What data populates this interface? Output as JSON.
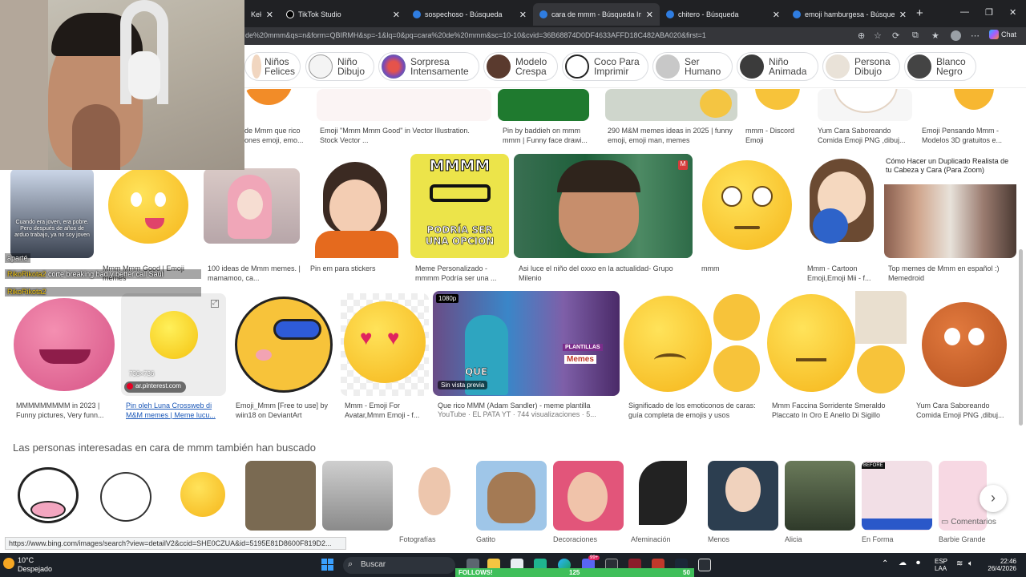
{
  "browser": {
    "tabs": [
      {
        "title": "Kekelar",
        "active": false
      },
      {
        "title": "TikTok Studio",
        "active": false
      },
      {
        "title": "sospechoso - Búsqueda",
        "active": false
      },
      {
        "title": "cara de mmm - Búsqueda Imágenes",
        "active": true
      },
      {
        "title": "chitero - Búsqueda",
        "active": false
      },
      {
        "title": "emoji hamburgesa - Búsqueda",
        "active": false
      }
    ],
    "url": "de%20mmm&qs=n&form=QBIRMH&sp=-1&lq=0&pq=cara%20de%20mmm&sc=10-10&cvid=36B68874D0DF4633AFFD18C482ABA020&first=1",
    "chat_label": "Chat"
  },
  "chips": [
    {
      "line1": "Niños",
      "line2": "Felices"
    },
    {
      "line1": "Niño",
      "line2": "Dibujo"
    },
    {
      "line1": "Sorpresa",
      "line2": "Intensamente"
    },
    {
      "line1": "Modelo",
      "line2": "Crespa"
    },
    {
      "line1": "Coco Para",
      "line2": "Imprimir"
    },
    {
      "line1": "Ser",
      "line2": "Humano"
    },
    {
      "line1": "Niño",
      "line2": "Animada"
    },
    {
      "line1": "Persona",
      "line2": "Dibujo"
    },
    {
      "line1": "Blanco",
      "line2": "Negro"
    }
  ],
  "row1_captions": [
    "de Mmm que rico ones emoji, emo...",
    "Emoji \"Mmm Mmm Good\" in Vector Illustration. Stock Vector ...",
    "Pin by baddieh on mmm mmm | Funny face drawi...",
    "290 M&M memes ideas in 2025 | funny emoji, emoji man, memes",
    "mmm - Discord Emoji",
    "Yum Cara Saboreando Comida Emoji PNG ,dibuj...",
    "Emoji Pensando Mmm - Modelos 3D gratuitos e..."
  ],
  "row2_captions": [
    "Mmm Mmm Good | Emoji memes",
    "100 ideas de Mmm memes. | mamamoo, ca...",
    "Pin em para stickers",
    "Meme Personalizado - mmmm Podría ser una ...",
    "Asi luce el niño del oxxo en la actualidad- Grupo Milenio",
    "mmm",
    "Mmm - Cartoon Emoji,Emoji Mii - f...",
    "Top memes de Mmm en español :) Memedroid"
  ],
  "row2_texts": {
    "spongebob_top": "MMMM",
    "spongebob_bottom": "PODRÍA SER UNA OPCION",
    "tutorial_title": "Cómo Hacer un Duplicado Realista de tu Cabeza y Cara (Para Zoom)",
    "card_text": "Cuando era joven, era pobre. Pero después de años de arduo trabajo, ya no soy joven"
  },
  "row3_captions": [
    "MMMMMMMMM in 2023 | Funny pictures, Very funn...",
    "Pin oleh Luna Crossweb di M&M memes | Meme lucu...",
    "Emoji_Mmm [Free to use] by wiin18 on DeviantArt",
    "Mmm - Emoji For Avatar,Mmm Emoji - f...",
    "Que rico MMM (Adam Sandler) - meme plantilla",
    "YouTube · EL PATA YT · 744 visualizaciones · 5...",
    "Significado de los emoticonos de caras: guía completa de emojis y usos",
    "Mmm Faccina Sorridente Smeraldo Placcato In Oro E Anello Di Sigillo",
    "Yum Cara Saboreando Comida Emoji PNG ,dibuj..."
  ],
  "row3_overlays": {
    "dims": "736×736",
    "source": "ar.pinterest.com",
    "badge_1080": "1080p",
    "sin_vista": "Sin vista previa",
    "que": "QUE",
    "plantillas": "PLANTILLAS",
    "memes": "Memes"
  },
  "related": {
    "title": "Las personas interesadas en cara de mmm también han buscado",
    "captions": [
      "Fotografías",
      "Gatito",
      "Decoraciones",
      "Afeminación",
      "Menos",
      "Alicia",
      "En Forma",
      "Barbie Grande"
    ],
    "feedback": "Comentarios"
  },
  "status_url": "https://www.bing.com/images/search?view=detailV2&ccid=SHE0CZUA&id=5195E81D8600F819D2...",
  "stream": {
    "chat_user_1": "aparté",
    "chat_user_2": "RikoRikota2",
    "chat_msg_2": "corte breaking bad y better call Saul",
    "chat_user_3": "RikoRikota2"
  },
  "taskbar": {
    "weather_temp": "10°C",
    "weather_desc": "Despejado",
    "search_placeholder": "Buscar",
    "lang1": "ESP",
    "lang2": "LAA",
    "time": "22:46",
    "date": "26/4/2026",
    "follows_label": "FOLLOWS!",
    "follows_count": "125",
    "follows_goal": "50",
    "notification_badge": "99+"
  },
  "colors": {
    "tab_bg": "#202124",
    "tab_active": "#35363a",
    "link": "#1a57b8",
    "follows_green": "#3fbf5a",
    "emoji_yellow": "#f7c33a"
  }
}
